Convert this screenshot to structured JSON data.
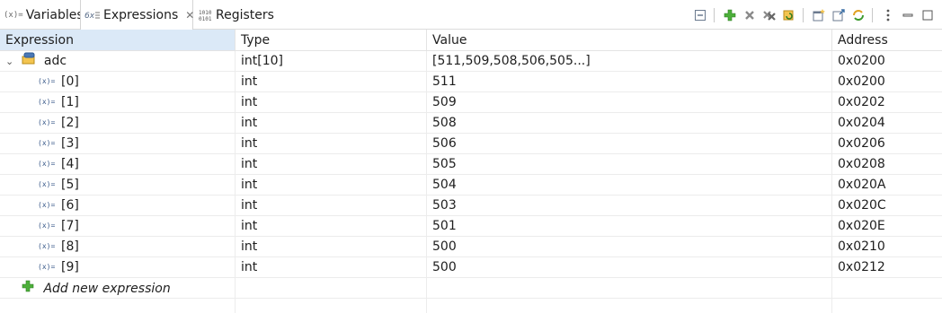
{
  "tabs": [
    {
      "label": "Variables",
      "icon": "variables-icon",
      "icon_text": "(x)="
    },
    {
      "label": "Expressions",
      "icon": "expressions-icon",
      "icon_text": "6x",
      "active": true
    },
    {
      "label": "Registers",
      "icon": "registers-icon",
      "icon_text": "1010\n0101"
    }
  ],
  "columns": [
    "Expression",
    "Type",
    "Value",
    "Address"
  ],
  "root": {
    "name": "adc",
    "type": "int[10]",
    "value": "[511,509,508,506,505...]",
    "address": "0x0200"
  },
  "rows": [
    {
      "name": "[0]",
      "type": "int",
      "value": "511",
      "address": "0x0200"
    },
    {
      "name": "[1]",
      "type": "int",
      "value": "509",
      "address": "0x0202"
    },
    {
      "name": "[2]",
      "type": "int",
      "value": "508",
      "address": "0x0204"
    },
    {
      "name": "[3]",
      "type": "int",
      "value": "506",
      "address": "0x0206"
    },
    {
      "name": "[4]",
      "type": "int",
      "value": "505",
      "address": "0x0208"
    },
    {
      "name": "[5]",
      "type": "int",
      "value": "504",
      "address": "0x020A"
    },
    {
      "name": "[6]",
      "type": "int",
      "value": "503",
      "address": "0x020C"
    },
    {
      "name": "[7]",
      "type": "int",
      "value": "501",
      "address": "0x020E"
    },
    {
      "name": "[8]",
      "type": "int",
      "value": "500",
      "address": "0x0210"
    },
    {
      "name": "[9]",
      "type": "int",
      "value": "500",
      "address": "0x0212"
    }
  ],
  "add_expression_label": "Add new expression",
  "toolbar_icons": [
    "collapse-all-icon",
    "add-expression-icon",
    "remove-icon",
    "remove-all-icon",
    "refresh-icon",
    "new-view-icon",
    "export-icon",
    "sync-icon",
    "view-menu-icon",
    "minimize-icon",
    "maximize-icon"
  ],
  "colors": {
    "header_selected": "#dbe9f7",
    "add_green": "#3c9a2d"
  }
}
